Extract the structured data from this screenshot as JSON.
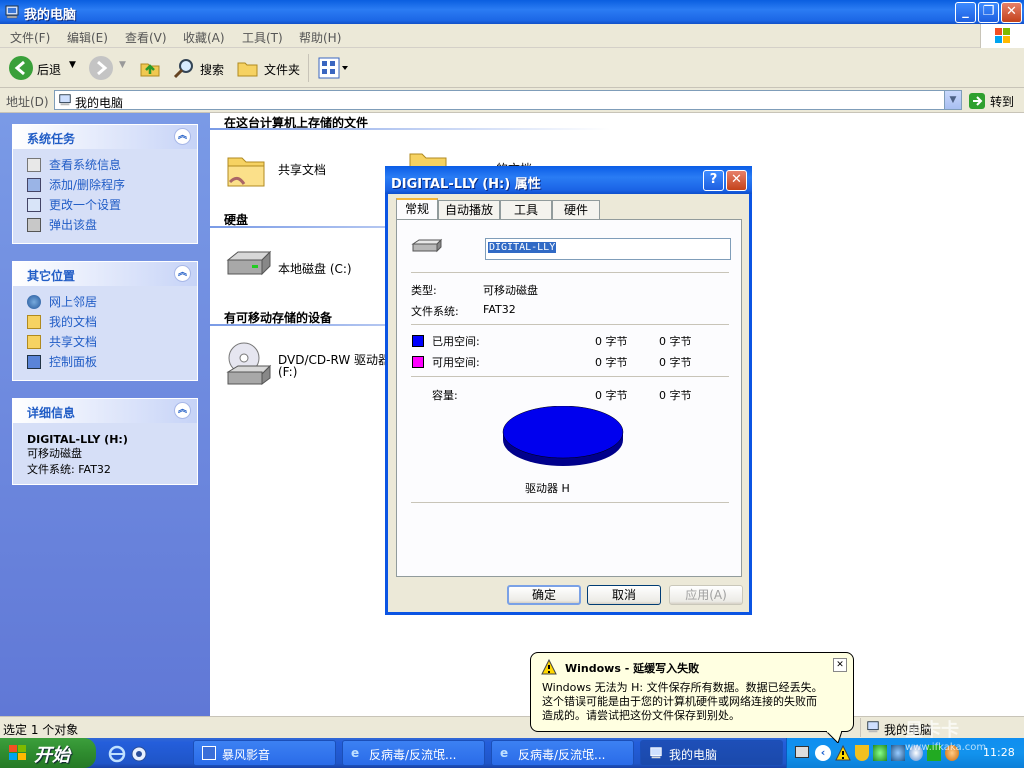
{
  "window": {
    "title": "我的电脑",
    "menu": [
      "文件(F)",
      "编辑(E)",
      "查看(V)",
      "收藏(A)",
      "工具(T)",
      "帮助(H)"
    ]
  },
  "toolbar": {
    "back": "后退",
    "search": "搜索",
    "folders": "文件夹"
  },
  "address": {
    "label": "地址(D)",
    "value": "我的电脑",
    "go": "转到"
  },
  "sidebar": {
    "system_tasks": {
      "title": "系统任务",
      "items": [
        "查看系统信息",
        "添加/删除程序",
        "更改一个设置",
        "弹出该盘"
      ]
    },
    "other_places": {
      "title": "其它位置",
      "items": [
        "网上邻居",
        "我的文档",
        "共享文档",
        "控制面板"
      ]
    },
    "details": {
      "title": "详细信息",
      "name": "DIGITAL-LLY (H:)",
      "type": "可移动磁盘",
      "fs": "文件系统: FAT32"
    }
  },
  "main": {
    "group1": "在这台计算机上存储的文件",
    "shared_docs": "共享文档",
    "hidden_folder_partial": "的文档",
    "group2": "硬盘",
    "local_disk": "本地磁盘 (C:)",
    "group3": "有可移动存储的设备",
    "dvd_line1": "DVD/CD-RW 驱动器",
    "dvd_line2": "(F:)"
  },
  "dialog": {
    "title": "DIGITAL-LLY (H:) 属性",
    "help_glyph": "?",
    "close_glyph": "✕",
    "tabs": [
      "常规",
      "自动播放",
      "工具",
      "硬件"
    ],
    "name_value": "DIGITAL-LLY",
    "type_label": "类型:",
    "type_value": "可移动磁盘",
    "fs_label": "文件系统:",
    "fs_value": "FAT32",
    "used_label": "已用空间:",
    "used_bytes": "0 字节",
    "used_size": "0 字节",
    "free_label": "可用空间:",
    "free_bytes": "0 字节",
    "free_size": "0 字节",
    "capacity_label": "容量:",
    "capacity_bytes": "0 字节",
    "capacity_size": "0 字节",
    "drive_label": "驱动器 H",
    "ok": "确定",
    "cancel": "取消",
    "apply": "应用(A)",
    "colors": {
      "used": "#0000ff",
      "free": "#ff00ff",
      "pie": "#0000ee"
    }
  },
  "balloon": {
    "title": "Windows - 延缓写入失败",
    "line1": "Windows 无法为 H: 文件保存所有数据。数据已经丢失。",
    "line2": "这个错误可能是由于您的计算机硬件或网络连接的失败而",
    "line3": "造成的。请尝试把这份文件保存到别处。"
  },
  "statusbar": {
    "left": "选定 1 个对象",
    "right": "我的电脑"
  },
  "taskbar": {
    "start": "开始",
    "tasks": [
      "暴风影音",
      "反病毒/反流氓...",
      "反病毒/反流氓...",
      "我的电脑"
    ],
    "clock": "11:28"
  },
  "watermark": {
    "line1": "星卡卡",
    "line2": "www.ifkaka.com"
  }
}
